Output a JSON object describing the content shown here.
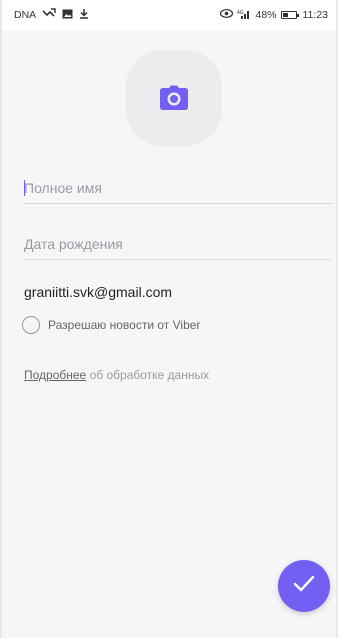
{
  "status_bar": {
    "carrier": "DNA",
    "battery": "48%",
    "battery_level": 0.48,
    "time": "11:23",
    "icons_left": [
      "missed-call-icon",
      "image-icon",
      "download-icon"
    ],
    "icons_right": [
      "eye-icon",
      "signal-icon",
      "battery-icon"
    ]
  },
  "profile": {
    "avatar_icon": "camera-icon",
    "full_name_placeholder": "Полное имя",
    "birth_date_placeholder": "Дата рождения",
    "email_value": "graniitti.svk@gmail.com",
    "newsletter_label": "Разрешаю новости от Viber",
    "newsletter_checked": false,
    "info_link": "Подробнее",
    "info_text": "об обработке данных"
  },
  "actions": {
    "confirm_icon": "checkmark-icon"
  },
  "colors": {
    "accent": "#7360f2",
    "background": "#f6f6f8",
    "avatar_bg": "#ececef"
  }
}
